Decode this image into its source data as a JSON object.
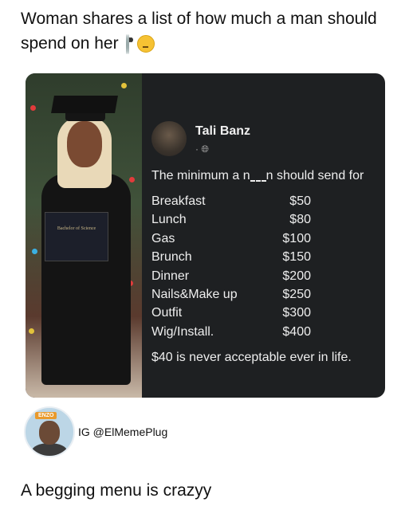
{
  "caption_top": "Woman shares a list of how much a man should spend on her",
  "post": {
    "author": "Tali Banz",
    "meta": "·",
    "intro_before": "The minimum a n",
    "intro_after": "n should send for",
    "items": [
      {
        "label": "Breakfast",
        "price": "$50"
      },
      {
        "label": "Lunch",
        "price": "$80"
      },
      {
        "label": "Gas",
        "price": "$100"
      },
      {
        "label": "Brunch",
        "price": "$150"
      },
      {
        "label": "Dinner",
        "price": "$200"
      },
      {
        "label": "Nails&Make up",
        "price": "$250"
      },
      {
        "label": "Outfit",
        "price": "$300"
      },
      {
        "label": "Wig/Install.",
        "price": "$400"
      }
    ],
    "note": "$40 is never acceptable ever in life."
  },
  "diploma_text": "Bachelor of Science",
  "credit": {
    "badge": "ENZO",
    "handle": "IG @ElMemePlug"
  },
  "caption_bottom": "A begging menu is crazyy",
  "icons": [
    "eyes-emoji-icon",
    "thinking-face-emoji-icon",
    "globe-icon"
  ],
  "colors": {
    "panel": "#1e2022",
    "text_light": "#eaeaea",
    "badge": "#e99a2c"
  }
}
